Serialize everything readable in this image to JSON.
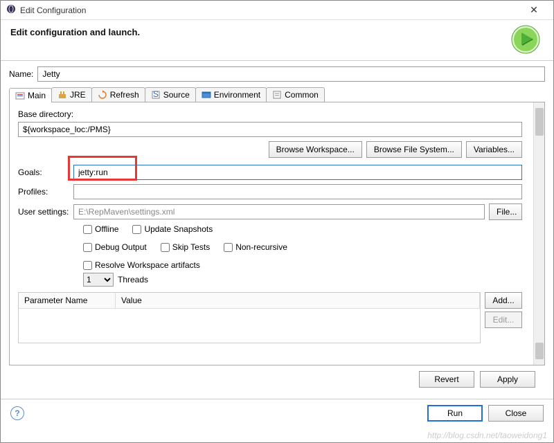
{
  "window": {
    "title": "Edit Configuration"
  },
  "header": {
    "heading": "Edit configuration and launch."
  },
  "name": {
    "label": "Name:",
    "value": "Jetty"
  },
  "tabs": [
    {
      "label": "Main"
    },
    {
      "label": "JRE"
    },
    {
      "label": "Refresh"
    },
    {
      "label": "Source"
    },
    {
      "label": "Environment"
    },
    {
      "label": "Common"
    }
  ],
  "main": {
    "baseDirLabel": "Base directory:",
    "baseDir": "${workspace_loc:/PMS}",
    "btnBrowseWs": "Browse Workspace...",
    "btnBrowseFs": "Browse File System...",
    "btnVariables": "Variables...",
    "goalsLabel": "Goals:",
    "goals": "jetty:run",
    "profilesLabel": "Profiles:",
    "profiles": "",
    "userSettingsLabel": "User settings:",
    "userSettings": "E:\\RepMaven\\settings.xml",
    "btnFile": "File...",
    "checks": {
      "offline": "Offline",
      "updateSnapshots": "Update Snapshots",
      "debugOutput": "Debug Output",
      "skipTests": "Skip Tests",
      "nonRecursive": "Non-recursive",
      "resolveWs": "Resolve Workspace artifacts"
    },
    "threads": {
      "value": "1",
      "label": "Threads"
    },
    "paramTable": {
      "colName": "Parameter Name",
      "colValue": "Value"
    },
    "btnAdd": "Add...",
    "btnEdit": "Edit..."
  },
  "footer": {
    "revert": "Revert",
    "apply": "Apply",
    "run": "Run",
    "close": "Close"
  },
  "watermark": "http://blog.csdn.net/taoweidong1"
}
